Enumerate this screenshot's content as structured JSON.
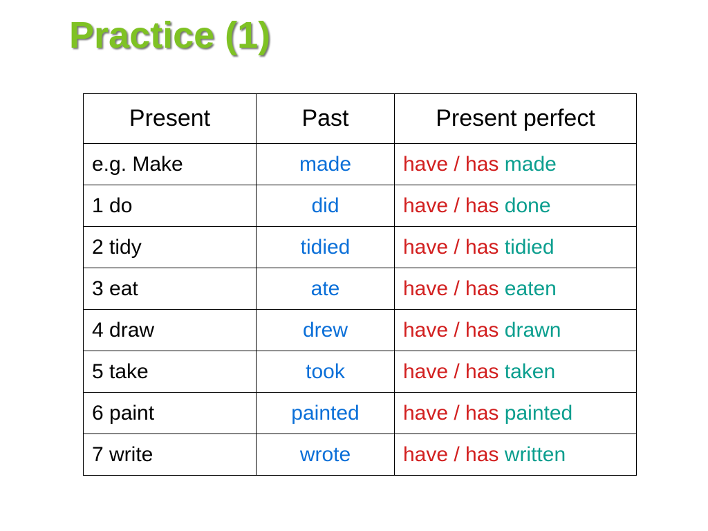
{
  "title": "Practice (1)",
  "headers": {
    "present": "Present",
    "past": "Past",
    "perfect": "Present perfect"
  },
  "aux": "have / has",
  "rows": [
    {
      "present": "e.g. Make",
      "past": "made",
      "pp": "made",
      "example": true
    },
    {
      "present": "1  do",
      "past": "did",
      "pp": "done"
    },
    {
      "present": "2  tidy",
      "past": "tidied",
      "pp": "tidied"
    },
    {
      "present": "3  eat",
      "past": "ate",
      "pp": "eaten"
    },
    {
      "present": "4  draw",
      "past": "drew",
      "pp": "drawn"
    },
    {
      "present": "5  take",
      "past": "took",
      "pp": "taken"
    },
    {
      "present": "6  paint",
      "past": "painted",
      "pp": "painted"
    },
    {
      "present": "7  write",
      "past": "wrote",
      "pp": "written"
    }
  ]
}
